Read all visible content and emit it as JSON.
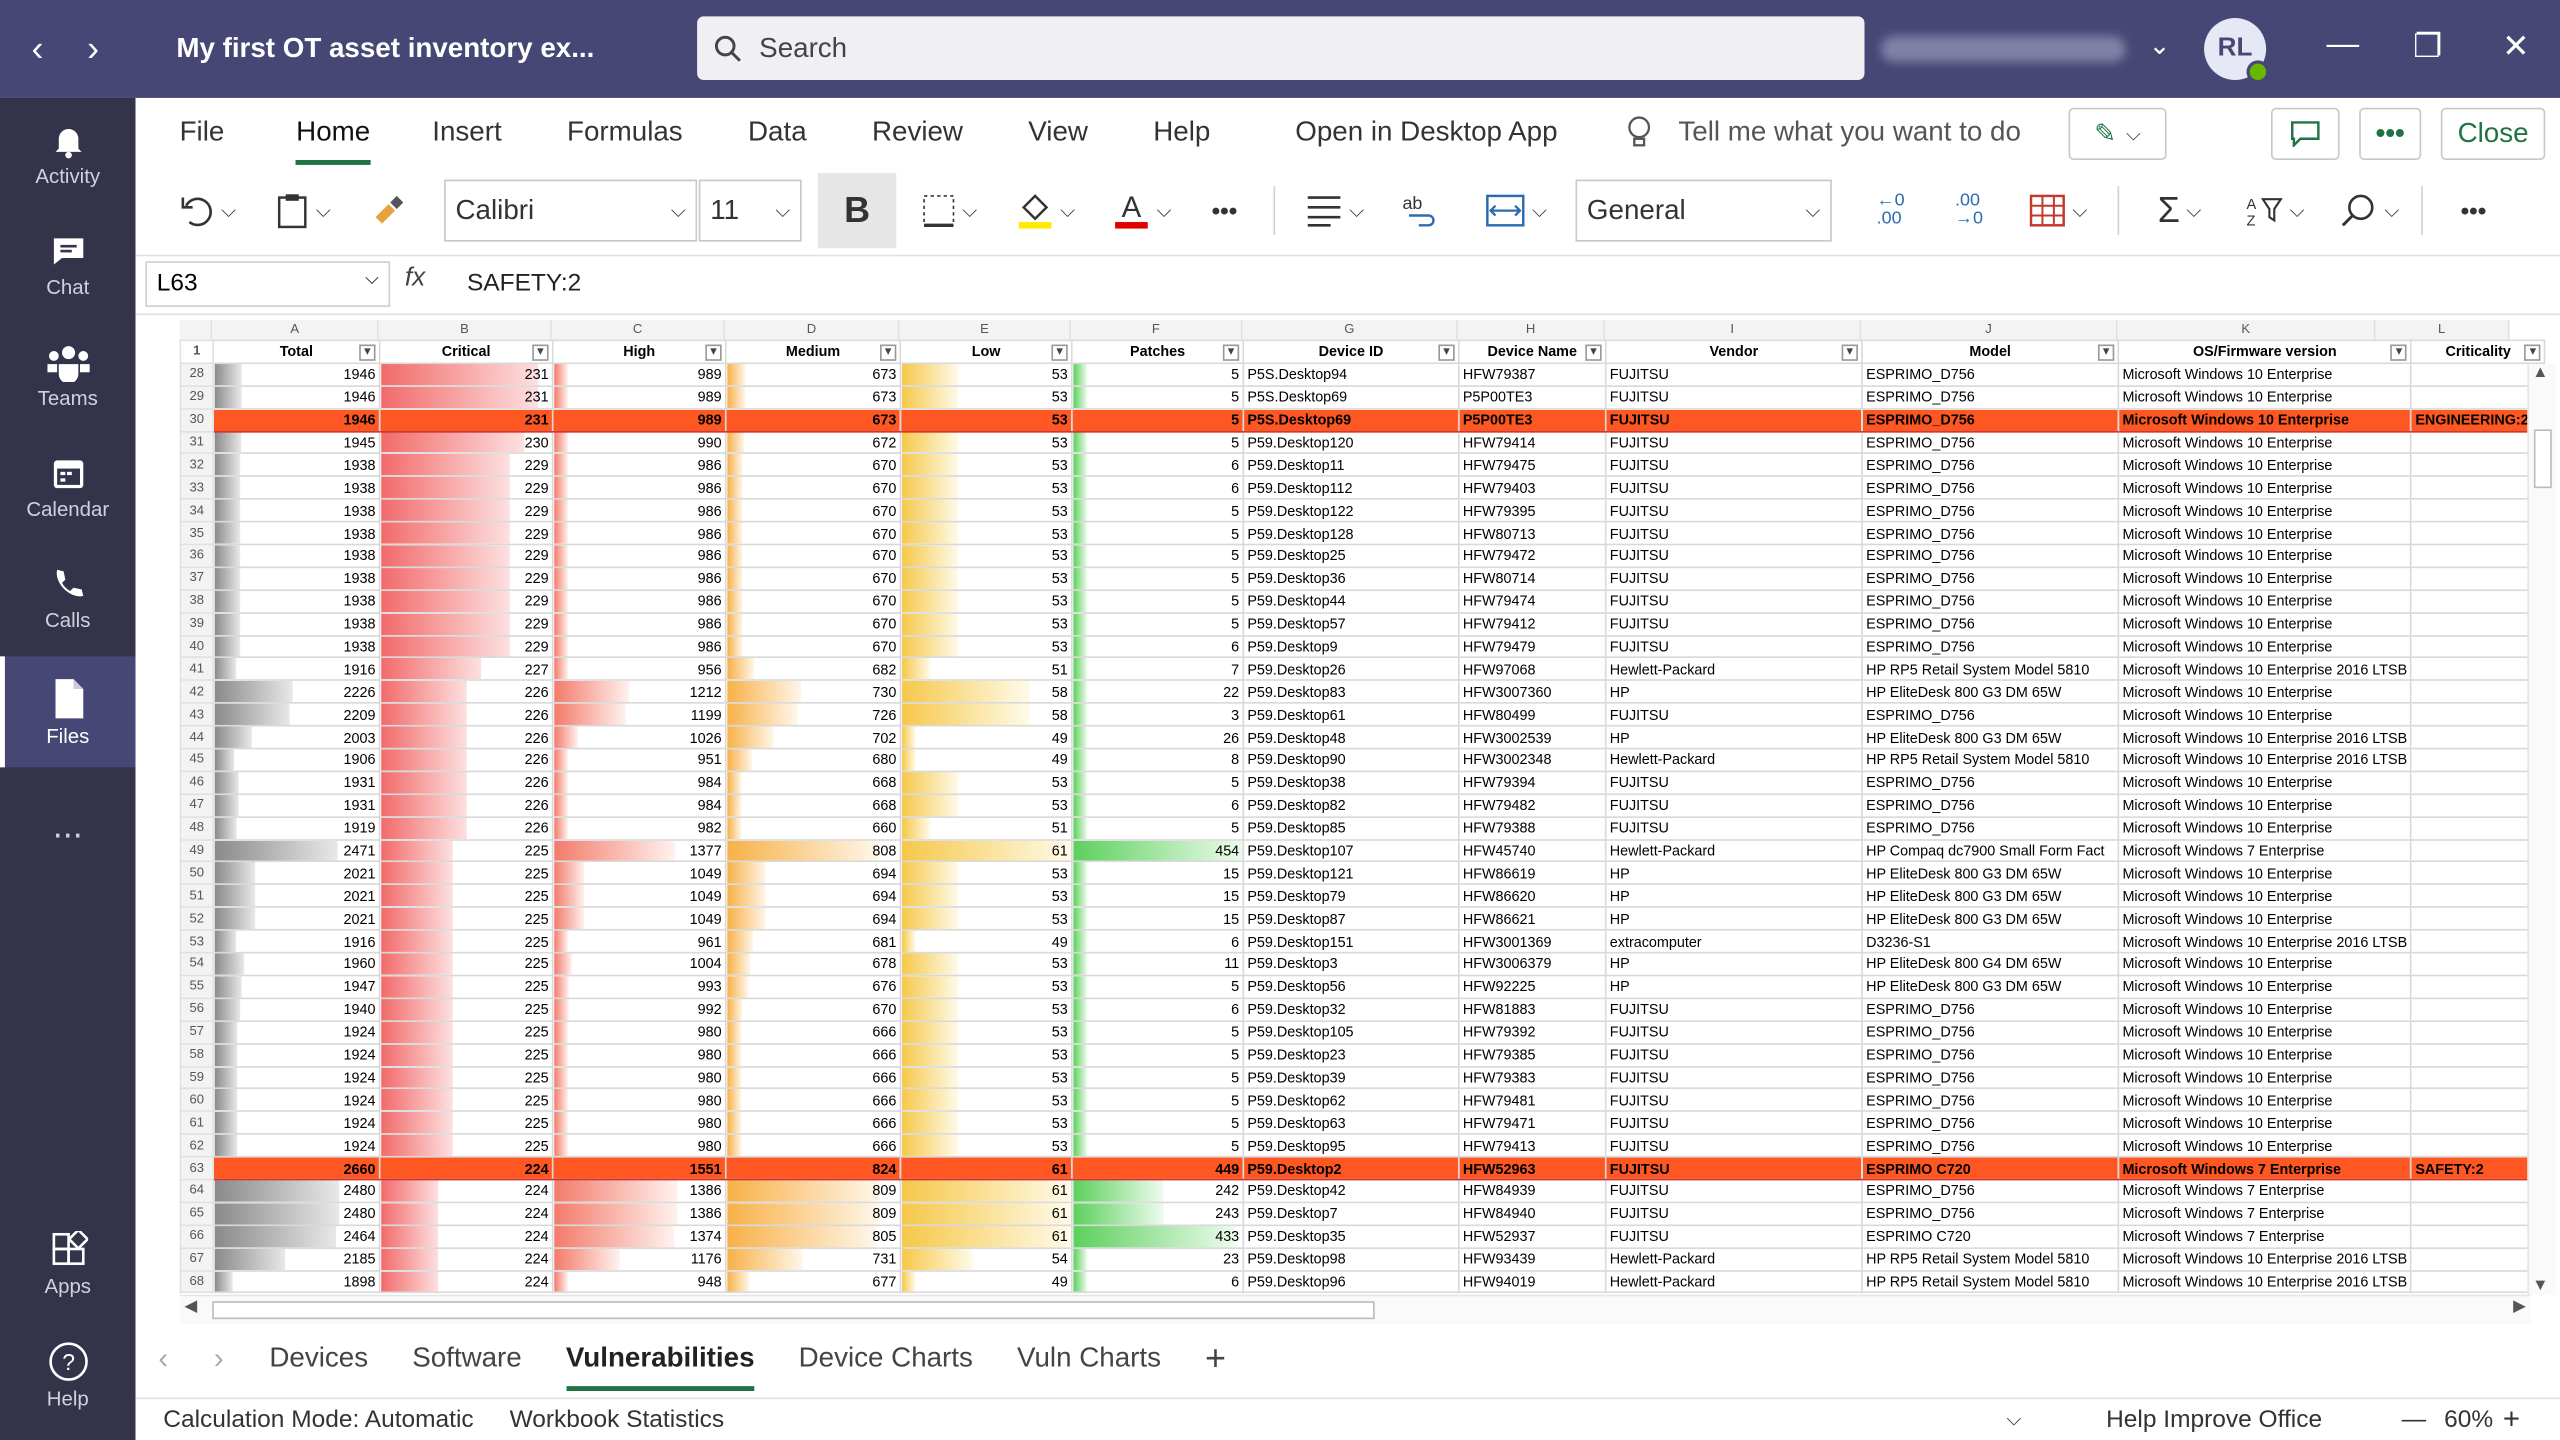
{
  "title": "My first OT asset inventory ex...",
  "search_placeholder": "Search",
  "avatar_initials": "RL",
  "rail": [
    {
      "label": "Activity",
      "icon": "bell-icon"
    },
    {
      "label": "Chat",
      "icon": "chat-icon"
    },
    {
      "label": "Teams",
      "icon": "teams-icon"
    },
    {
      "label": "Calendar",
      "icon": "calendar-icon"
    },
    {
      "label": "Calls",
      "icon": "phone-icon"
    },
    {
      "label": "Files",
      "icon": "file-icon"
    },
    {
      "label": "...",
      "icon": "more-icon"
    },
    {
      "label": "Apps",
      "icon": "apps-icon"
    },
    {
      "label": "Help",
      "icon": "help-icon"
    }
  ],
  "ribbon_tabs": [
    "File",
    "Home",
    "Insert",
    "Formulas",
    "Data",
    "Review",
    "View",
    "Help"
  ],
  "open_desktop": "Open in Desktop App",
  "tell_me": "Tell me what you want to do",
  "close_label": "Close",
  "font_name": "Calibri",
  "font_size": "11",
  "number_format": "General",
  "name_box": "L63",
  "formula": "SAFETY:2",
  "column_letters": [
    "A",
    "B",
    "C",
    "D",
    "E",
    "F",
    "G",
    "H",
    "I",
    "J",
    "K",
    "L"
  ],
  "headers": [
    "Total",
    "Critical",
    "High",
    "Medium",
    "Low",
    "Patches",
    "Device ID",
    "Device Name",
    "Vendor",
    "Model",
    "OS/Firmware version",
    "Criticality"
  ],
  "header_row_num": "1",
  "rows": [
    [
      "28",
      "1946",
      "231",
      "989",
      "673",
      "53",
      "5",
      "P5S.Desktop94",
      "HFW79387",
      "FUJITSU",
      "ESPRIMO_D756",
      "Microsoft Windows 10 Enterprise",
      ""
    ],
    [
      "29",
      "1946",
      "231",
      "989",
      "673",
      "53",
      "5",
      "P5S.Desktop69",
      "P5P00TE3",
      "FUJITSU",
      "ESPRIMO_D756",
      "Microsoft Windows 10 Enterprise",
      ""
    ],
    [
      "30",
      "1946",
      "231",
      "989",
      "673",
      "53",
      "5",
      "P5S.Desktop69",
      "P5P00TE3",
      "FUJITSU",
      "ESPRIMO_D756",
      "Microsoft Windows 10 Enterprise",
      "ENGINEERING:2"
    ],
    [
      "31",
      "1945",
      "230",
      "990",
      "672",
      "53",
      "5",
      "P59.Desktop120",
      "HFW79414",
      "FUJITSU",
      "ESPRIMO_D756",
      "Microsoft Windows 10 Enterprise",
      ""
    ],
    [
      "32",
      "1938",
      "229",
      "986",
      "670",
      "53",
      "6",
      "P59.Desktop11",
      "HFW79475",
      "FUJITSU",
      "ESPRIMO_D756",
      "Microsoft Windows 10 Enterprise",
      ""
    ],
    [
      "33",
      "1938",
      "229",
      "986",
      "670",
      "53",
      "6",
      "P59.Desktop112",
      "HFW79403",
      "FUJITSU",
      "ESPRIMO_D756",
      "Microsoft Windows 10 Enterprise",
      ""
    ],
    [
      "34",
      "1938",
      "229",
      "986",
      "670",
      "53",
      "5",
      "P59.Desktop122",
      "HFW79395",
      "FUJITSU",
      "ESPRIMO_D756",
      "Microsoft Windows 10 Enterprise",
      ""
    ],
    [
      "35",
      "1938",
      "229",
      "986",
      "670",
      "53",
      "5",
      "P59.Desktop128",
      "HFW80713",
      "FUJITSU",
      "ESPRIMO_D756",
      "Microsoft Windows 10 Enterprise",
      ""
    ],
    [
      "36",
      "1938",
      "229",
      "986",
      "670",
      "53",
      "5",
      "P59.Desktop25",
      "HFW79472",
      "FUJITSU",
      "ESPRIMO_D756",
      "Microsoft Windows 10 Enterprise",
      ""
    ],
    [
      "37",
      "1938",
      "229",
      "986",
      "670",
      "53",
      "5",
      "P59.Desktop36",
      "HFW80714",
      "FUJITSU",
      "ESPRIMO_D756",
      "Microsoft Windows 10 Enterprise",
      ""
    ],
    [
      "38",
      "1938",
      "229",
      "986",
      "670",
      "53",
      "5",
      "P59.Desktop44",
      "HFW79474",
      "FUJITSU",
      "ESPRIMO_D756",
      "Microsoft Windows 10 Enterprise",
      ""
    ],
    [
      "39",
      "1938",
      "229",
      "986",
      "670",
      "53",
      "5",
      "P59.Desktop57",
      "HFW79412",
      "FUJITSU",
      "ESPRIMO_D756",
      "Microsoft Windows 10 Enterprise",
      ""
    ],
    [
      "40",
      "1938",
      "229",
      "986",
      "670",
      "53",
      "6",
      "P59.Desktop9",
      "HFW79479",
      "FUJITSU",
      "ESPRIMO_D756",
      "Microsoft Windows 10 Enterprise",
      ""
    ],
    [
      "41",
      "1916",
      "227",
      "956",
      "682",
      "51",
      "7",
      "P59.Desktop26",
      "HFW97068",
      "Hewlett-Packard",
      "HP RP5 Retail System Model 5810",
      "Microsoft Windows 10 Enterprise 2016 LTSB",
      ""
    ],
    [
      "42",
      "2226",
      "226",
      "1212",
      "730",
      "58",
      "22",
      "P59.Desktop83",
      "HFW3007360",
      "HP",
      "HP EliteDesk 800 G3 DM 65W",
      "Microsoft Windows 10 Enterprise",
      ""
    ],
    [
      "43",
      "2209",
      "226",
      "1199",
      "726",
      "58",
      "3",
      "P59.Desktop61",
      "HFW80499",
      "FUJITSU",
      "ESPRIMO_D756",
      "Microsoft Windows 10 Enterprise",
      ""
    ],
    [
      "44",
      "2003",
      "226",
      "1026",
      "702",
      "49",
      "26",
      "P59.Desktop48",
      "HFW3002539",
      "HP",
      "HP EliteDesk 800 G3 DM 65W",
      "Microsoft Windows 10 Enterprise 2016 LTSB",
      ""
    ],
    [
      "45",
      "1906",
      "226",
      "951",
      "680",
      "49",
      "8",
      "P59.Desktop90",
      "HFW3002348",
      "Hewlett-Packard",
      "HP RP5 Retail System Model 5810",
      "Microsoft Windows 10 Enterprise 2016 LTSB",
      ""
    ],
    [
      "46",
      "1931",
      "226",
      "984",
      "668",
      "53",
      "5",
      "P59.Desktop38",
      "HFW79394",
      "FUJITSU",
      "ESPRIMO_D756",
      "Microsoft Windows 10 Enterprise",
      ""
    ],
    [
      "47",
      "1931",
      "226",
      "984",
      "668",
      "53",
      "6",
      "P59.Desktop82",
      "HFW79482",
      "FUJITSU",
      "ESPRIMO_D756",
      "Microsoft Windows 10 Enterprise",
      ""
    ],
    [
      "48",
      "1919",
      "226",
      "982",
      "660",
      "51",
      "5",
      "P59.Desktop85",
      "HFW79388",
      "FUJITSU",
      "ESPRIMO_D756",
      "Microsoft Windows 10 Enterprise",
      ""
    ],
    [
      "49",
      "2471",
      "225",
      "1377",
      "808",
      "61",
      "454",
      "P59.Desktop107",
      "HFW45740",
      "Hewlett-Packard",
      "HP Compaq dc7900 Small Form Fact",
      "Microsoft Windows 7 Enterprise",
      ""
    ],
    [
      "50",
      "2021",
      "225",
      "1049",
      "694",
      "53",
      "15",
      "P59.Desktop121",
      "HFW86619",
      "HP",
      "HP EliteDesk 800 G3 DM 65W",
      "Microsoft Windows 10 Enterprise",
      ""
    ],
    [
      "51",
      "2021",
      "225",
      "1049",
      "694",
      "53",
      "15",
      "P59.Desktop79",
      "HFW86620",
      "HP",
      "HP EliteDesk 800 G3 DM 65W",
      "Microsoft Windows 10 Enterprise",
      ""
    ],
    [
      "52",
      "2021",
      "225",
      "1049",
      "694",
      "53",
      "15",
      "P59.Desktop87",
      "HFW86621",
      "HP",
      "HP EliteDesk 800 G3 DM 65W",
      "Microsoft Windows 10 Enterprise",
      ""
    ],
    [
      "53",
      "1916",
      "225",
      "961",
      "681",
      "49",
      "6",
      "P59.Desktop151",
      "HFW3001369",
      "extracomputer",
      "D3236-S1",
      "Microsoft Windows 10 Enterprise 2016 LTSB",
      ""
    ],
    [
      "54",
      "1960",
      "225",
      "1004",
      "678",
      "53",
      "11",
      "P59.Desktop3",
      "HFW3006379",
      "HP",
      "HP EliteDesk 800 G4 DM 65W",
      "Microsoft Windows 10 Enterprise",
      ""
    ],
    [
      "55",
      "1947",
      "225",
      "993",
      "676",
      "53",
      "5",
      "P59.Desktop56",
      "HFW92225",
      "HP",
      "HP EliteDesk 800 G3 DM 65W",
      "Microsoft Windows 10 Enterprise",
      ""
    ],
    [
      "56",
      "1940",
      "225",
      "992",
      "670",
      "53",
      "6",
      "P59.Desktop32",
      "HFW81883",
      "FUJITSU",
      "ESPRIMO_D756",
      "Microsoft Windows 10 Enterprise",
      ""
    ],
    [
      "57",
      "1924",
      "225",
      "980",
      "666",
      "53",
      "5",
      "P59.Desktop105",
      "HFW79392",
      "FUJITSU",
      "ESPRIMO_D756",
      "Microsoft Windows 10 Enterprise",
      ""
    ],
    [
      "58",
      "1924",
      "225",
      "980",
      "666",
      "53",
      "5",
      "P59.Desktop23",
      "HFW79385",
      "FUJITSU",
      "ESPRIMO_D756",
      "Microsoft Windows 10 Enterprise",
      ""
    ],
    [
      "59",
      "1924",
      "225",
      "980",
      "666",
      "53",
      "5",
      "P59.Desktop39",
      "HFW79383",
      "FUJITSU",
      "ESPRIMO_D756",
      "Microsoft Windows 10 Enterprise",
      ""
    ],
    [
      "60",
      "1924",
      "225",
      "980",
      "666",
      "53",
      "5",
      "P59.Desktop62",
      "HFW79481",
      "FUJITSU",
      "ESPRIMO_D756",
      "Microsoft Windows 10 Enterprise",
      ""
    ],
    [
      "61",
      "1924",
      "225",
      "980",
      "666",
      "53",
      "5",
      "P59.Desktop63",
      "HFW79471",
      "FUJITSU",
      "ESPRIMO_D756",
      "Microsoft Windows 10 Enterprise",
      ""
    ],
    [
      "62",
      "1924",
      "225",
      "980",
      "666",
      "53",
      "5",
      "P59.Desktop95",
      "HFW79413",
      "FUJITSU",
      "ESPRIMO_D756",
      "Microsoft Windows 10 Enterprise",
      ""
    ],
    [
      "63",
      "2660",
      "224",
      "1551",
      "824",
      "61",
      "449",
      "P59.Desktop2",
      "HFW52963",
      "FUJITSU",
      "ESPRIMO C720",
      "Microsoft Windows 7 Enterprise",
      "SAFETY:2"
    ],
    [
      "64",
      "2480",
      "224",
      "1386",
      "809",
      "61",
      "242",
      "P59.Desktop42",
      "HFW84939",
      "FUJITSU",
      "ESPRIMO_D756",
      "Microsoft Windows 7 Enterprise",
      ""
    ],
    [
      "65",
      "2480",
      "224",
      "1386",
      "809",
      "61",
      "243",
      "P59.Desktop7",
      "HFW84940",
      "FUJITSU",
      "ESPRIMO_D756",
      "Microsoft Windows 7 Enterprise",
      ""
    ],
    [
      "66",
      "2464",
      "224",
      "1374",
      "805",
      "61",
      "433",
      "P59.Desktop35",
      "HFW52937",
      "FUJITSU",
      "ESPRIMO C720",
      "Microsoft Windows 7 Enterprise",
      ""
    ],
    [
      "67",
      "2185",
      "224",
      "1176",
      "731",
      "54",
      "23",
      "P59.Desktop98",
      "HFW93439",
      "Hewlett-Packard",
      "HP RP5 Retail System Model 5810",
      "Microsoft Windows 10 Enterprise 2016 LTSB",
      ""
    ],
    [
      "68",
      "1898",
      "224",
      "948",
      "677",
      "49",
      "6",
      "P59.Desktop96",
      "HFW94019",
      "Hewlett-Packard",
      "HP RP5 Retail System Model 5810",
      "Microsoft Windows 10 Enterprise 2016 LTSB",
      ""
    ]
  ],
  "highlight_rows": [
    "30",
    "63"
  ],
  "sheet_tabs": [
    "Devices",
    "Software",
    "Vulnerabilities",
    "Device Charts",
    "Vuln Charts"
  ],
  "active_sheet": "Vulnerabilities",
  "status": {
    "calc": "Calculation Mode: Automatic",
    "stats": "Workbook Statistics",
    "help": "Help Improve Office",
    "zoom": "60%"
  },
  "colors": {
    "teams_purple": "#464775",
    "rail": "#33344a",
    "excel_green": "#217346",
    "highlight": "#ff5722"
  }
}
